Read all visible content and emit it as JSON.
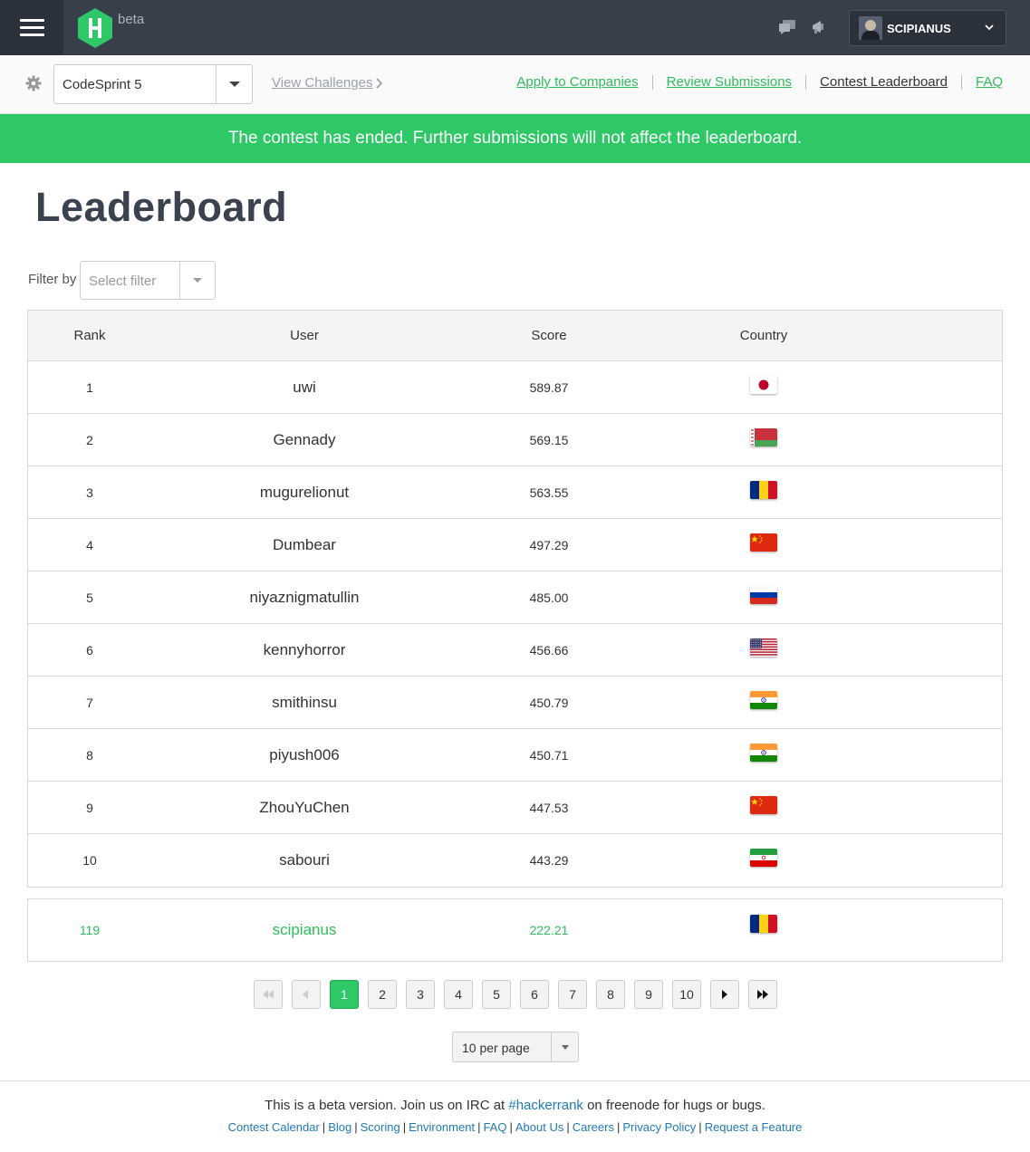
{
  "header": {
    "beta": "beta",
    "username": "SCIPIANUS"
  },
  "subnav": {
    "contest": "CodeSprint 5",
    "view_challenges": "View Challenges",
    "links": [
      "Apply to Companies",
      "Review Submissions",
      "Contest Leaderboard",
      "FAQ"
    ]
  },
  "banner": "The contest has ended. Further submissions will not affect the leaderboard.",
  "title": "Leaderboard",
  "filter": {
    "label": "Filter by",
    "placeholder": "Select filter"
  },
  "table": {
    "columns": [
      "Rank",
      "User",
      "Score",
      "Country"
    ],
    "rows": [
      {
        "rank": "1",
        "user": "uwi",
        "score": "589.87",
        "country": "japan"
      },
      {
        "rank": "2",
        "user": "Gennady",
        "score": "569.15",
        "country": "belarus"
      },
      {
        "rank": "3",
        "user": "mugurelionut",
        "score": "563.55",
        "country": "romania"
      },
      {
        "rank": "4",
        "user": "Dumbear",
        "score": "497.29",
        "country": "china"
      },
      {
        "rank": "5",
        "user": "niyaznigmatullin",
        "score": "485.00",
        "country": "russia"
      },
      {
        "rank": "6",
        "user": "kennyhorror",
        "score": "456.66",
        "country": "usa"
      },
      {
        "rank": "7",
        "user": "smithinsu",
        "score": "450.79",
        "country": "india"
      },
      {
        "rank": "8",
        "user": "piyush006",
        "score": "450.71",
        "country": "india"
      },
      {
        "rank": "9",
        "user": "ZhouYuChen",
        "score": "447.53",
        "country": "china"
      },
      {
        "rank": "10",
        "user": "sabouri",
        "score": "443.29",
        "country": "iran"
      }
    ],
    "me": {
      "rank": "119",
      "user": "scipianus",
      "score": "222.21",
      "country": "romania"
    }
  },
  "pagination": {
    "pages": [
      "1",
      "2",
      "3",
      "4",
      "5",
      "6",
      "7",
      "8",
      "9",
      "10"
    ],
    "current": "1",
    "per_page": "10 per page"
  },
  "footer": {
    "text_before": "This is a beta version. Join us on IRC at ",
    "irc_link": "#hackerrank",
    "text_after": " on freenode for hugs or bugs.",
    "links": [
      "Contest Calendar",
      "Blog",
      "Scoring",
      "Environment",
      "FAQ",
      "About Us",
      "Careers",
      "Privacy Policy",
      "Request a Feature"
    ]
  },
  "colors": {
    "brand_green": "#2ec866",
    "link_green": "#2ebd5b",
    "topbar": "#373f4b",
    "footer_link": "#1f7ab5"
  }
}
